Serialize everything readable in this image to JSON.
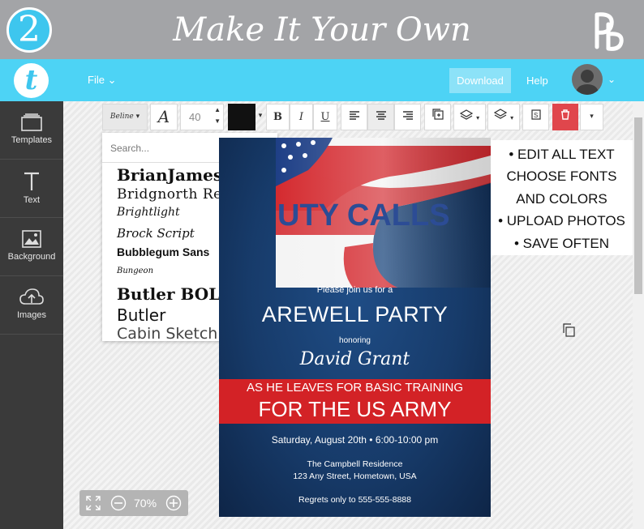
{
  "banner": {
    "step": "2",
    "title": "Make It Your Own"
  },
  "topbar": {
    "file_label": "File",
    "download_label": "Download",
    "help_label": "Help"
  },
  "sidebar": {
    "items": [
      {
        "label": "Templates",
        "icon": "templates-icon"
      },
      {
        "label": "Text",
        "icon": "text-icon"
      },
      {
        "label": "Background",
        "icon": "background-icon"
      },
      {
        "label": "Images",
        "icon": "cloud-upload-icon"
      }
    ]
  },
  "toolbar": {
    "font_size": "40",
    "color": "#111111",
    "bold": "B",
    "italic": "I",
    "underline": "U"
  },
  "font_dropdown": {
    "search_placeholder": "Search...",
    "fonts": [
      "BrianJames",
      "Bridgnorth Regular",
      "Brightlight",
      "Brock Script",
      "Bubblegum Sans",
      "Bungeon",
      "Butler BOLD",
      "Butler",
      "Cabin Sketch"
    ]
  },
  "card": {
    "duty": "UTY CALLS",
    "invite": "Please join us for a",
    "party": "AREWELL PARTY",
    "honoring": "honoring",
    "name": "David Grant",
    "line1": "AS HE LEAVES FOR BASIC TRAINING",
    "line2": "FOR THE US ARMY",
    "date": "Saturday, August 20th • 6:00-10:00 pm",
    "venue": "The Campbell Residence",
    "address": "123 Any Street, Hometown, USA",
    "rsvp": "Regrets only to 555-555-8888"
  },
  "overlay_lines": [
    "• EDIT ALL TEXT",
    "CHOOSE FONTS",
    "AND COLORS",
    "• UPLOAD PHOTOS",
    "• SAVE  OFTEN"
  ],
  "zoom": {
    "level": "70%"
  },
  "colors": {
    "accent": "#4dd3f5",
    "banner": "#a3a4a7",
    "sidebar": "#3a3a3a",
    "delete": "#e0464c",
    "navy": "#173b6a",
    "red": "#d32226"
  }
}
